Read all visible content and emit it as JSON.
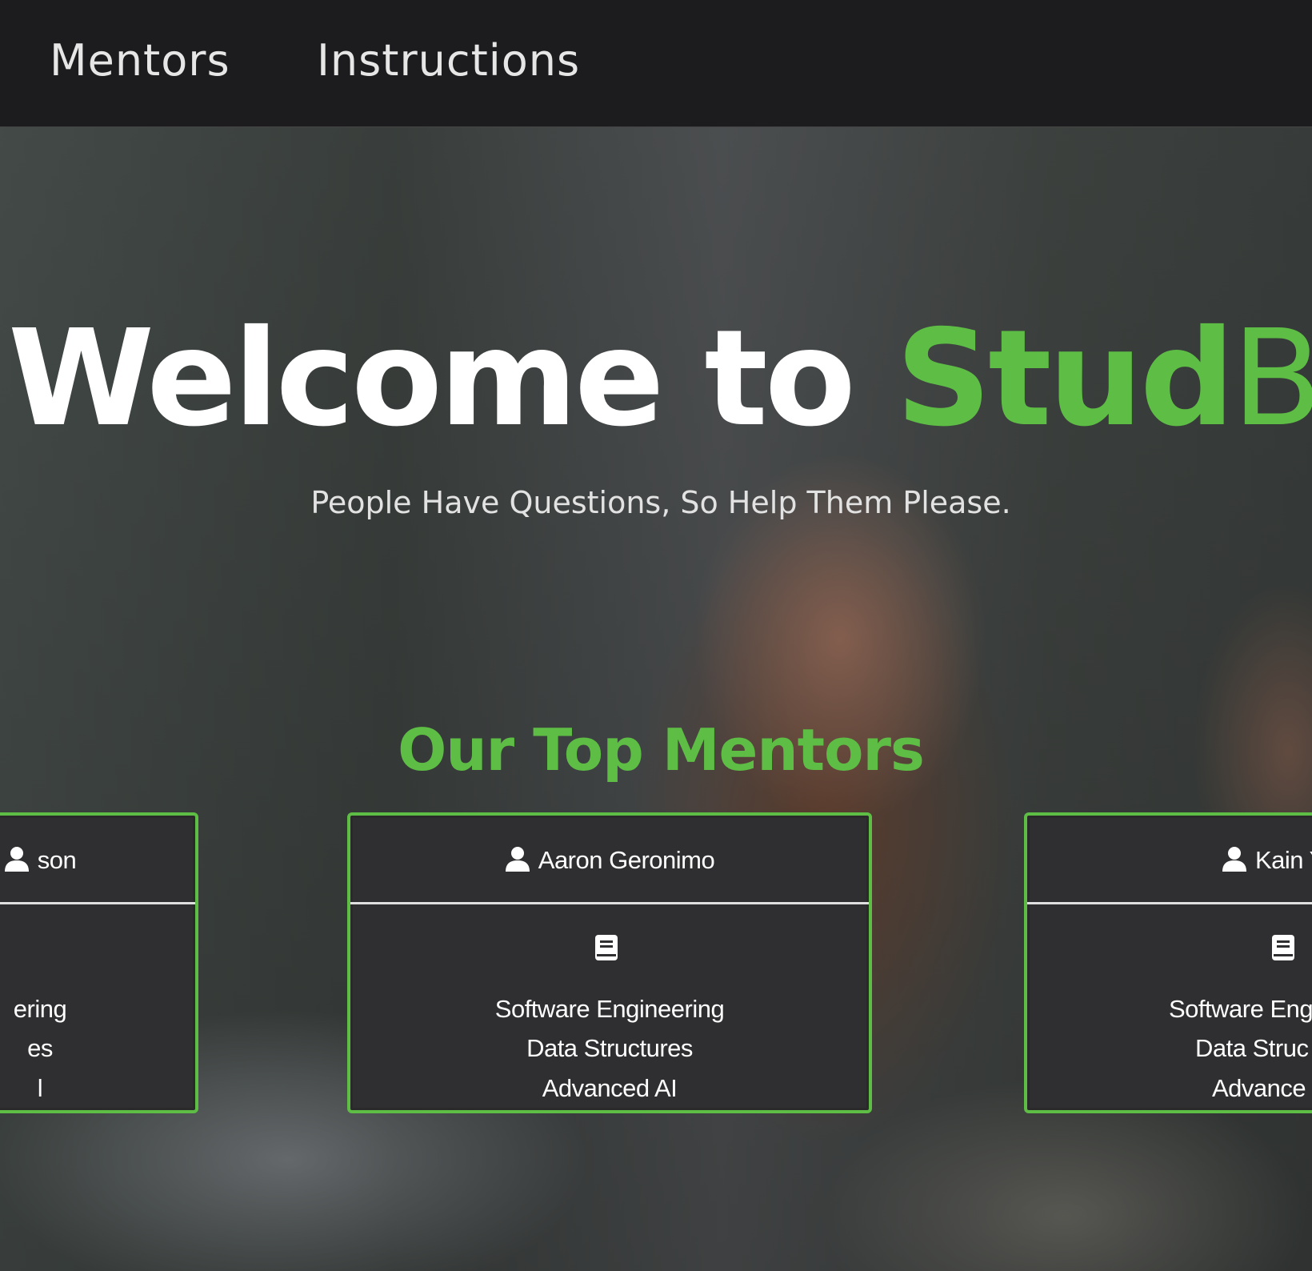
{
  "nav": {
    "links": [
      "Mentors",
      "Instructions"
    ]
  },
  "hero": {
    "title_prefix": "Welcome to ",
    "title_brand_bold": "Stud",
    "title_brand_light": "Budd",
    "subtitle": "People Have Questions, So Help Them Please."
  },
  "mentors_section": {
    "title": "Our Top Mentors",
    "cards": [
      {
        "name": "son",
        "subjects": [
          "ering",
          "es",
          "l"
        ]
      },
      {
        "name": "Aaron Geronimo",
        "subjects": [
          "Software Engineering",
          "Data Structures",
          "Advanced AI"
        ]
      },
      {
        "name": "Kain Y",
        "subjects": [
          "Software Eng",
          "Data Struc",
          "Advance"
        ]
      }
    ]
  },
  "colors": {
    "brand_green": "#5dbd44",
    "navbar_bg": "#1c1c1e",
    "card_bg": "#2f2f31"
  },
  "icons": {
    "card_header": "user-icon",
    "card_body": "book-icon"
  }
}
